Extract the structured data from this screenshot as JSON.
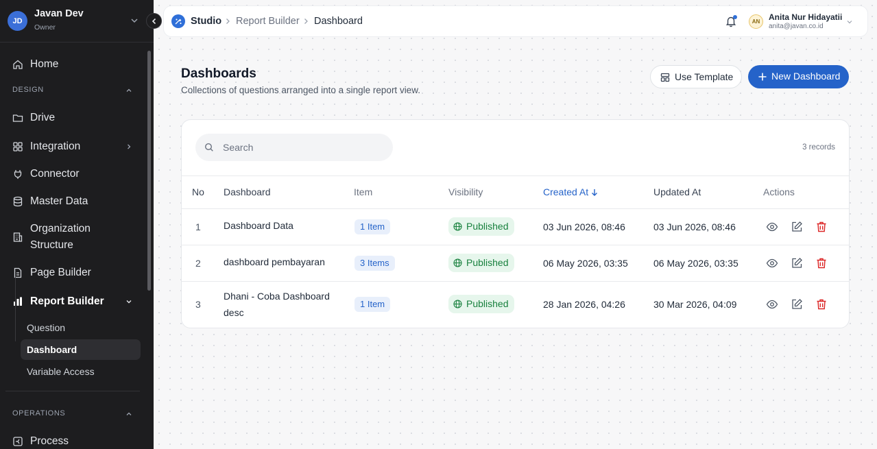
{
  "workspace": {
    "initials": "JD",
    "name": "Javan Dev",
    "role": "Owner"
  },
  "sidebar": {
    "home": "Home",
    "design_label": "DESIGN",
    "items": {
      "drive": "Drive",
      "integration": "Integration",
      "connector": "Connector",
      "master_data": "Master Data",
      "org_line1": "Organization",
      "org_line2": "Structure",
      "page_builder": "Page Builder",
      "report_builder": "Report Builder"
    },
    "report_sub": [
      "Question",
      "Dashboard",
      "Variable Access"
    ],
    "operations_label": "OPERATIONS",
    "process": "Process"
  },
  "topbar": {
    "breadcrumb": [
      "Studio",
      "Report Builder",
      "Dashboard"
    ],
    "user": {
      "initials": "AN",
      "name": "Anita Nur Hidayatii",
      "email": "anita@javan.co.id"
    }
  },
  "page": {
    "title": "Dashboards",
    "subtitle": "Collections of questions arranged into a single report view.",
    "use_template": "Use Template",
    "new_dashboard": "New Dashboard"
  },
  "table": {
    "search_placeholder": "Search",
    "records": "3 records",
    "columns": {
      "no": "No",
      "dashboard": "Dashboard",
      "item": "Item",
      "visibility": "Visibility",
      "created": "Created At",
      "updated": "Updated At",
      "actions": "Actions"
    },
    "rows": [
      {
        "no": "1",
        "name_line1": "Dashboard Data",
        "name_line2": "",
        "item": "1 Item",
        "visibility": "Published",
        "created": "03 Jun 2026, 08:46",
        "updated": "03 Jun 2026, 08:46"
      },
      {
        "no": "2",
        "name_line1": "dashboard pembayaran",
        "name_line2": "",
        "item": "3 Items",
        "visibility": "Published",
        "created": "06 May 2026, 03:35",
        "updated": "06 May 2026, 03:35"
      },
      {
        "no": "3",
        "name_line1": "Dhani - Coba Dashboard",
        "name_line2": "desc",
        "item": "1 Item",
        "visibility": "Published",
        "created": "28 Jan 2026, 04:26",
        "updated": "30 Mar 2026, 04:09"
      }
    ]
  },
  "colors": {
    "accent": "#2563c9",
    "published": "#17803d",
    "delete": "#dc2626",
    "sidebar_bg": "#1d1d1f"
  }
}
